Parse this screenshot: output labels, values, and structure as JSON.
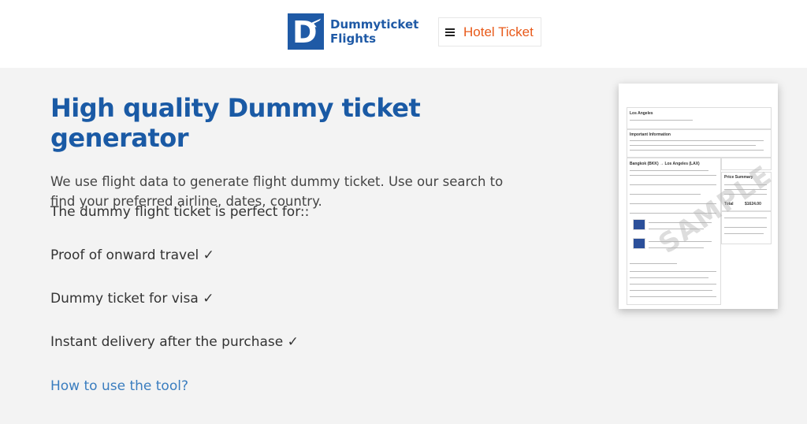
{
  "header": {
    "logo": {
      "line1": "Dummyticket",
      "line2": "Flights"
    },
    "hotel_button": {
      "label": "Hotel Ticket"
    }
  },
  "main": {
    "title": "High quality Dummy ticket generator",
    "intro": "We use flight data to generate flight dummy ticket. Use our search to find your preferred airline, dates, country.",
    "perfect_for": "The dummy flight ticket is perfect for::",
    "features": [
      "Proof of onward travel ✓",
      "Dummy ticket for visa ✓",
      "Instant delivery after the purchase  ✓"
    ],
    "how_link": "How to use the tool?"
  },
  "sample": {
    "city": "Los Angeles",
    "section1": "Important Information",
    "route": "Bangkok (BKK) → Los Angeles (LAX)",
    "price_summary": "Price Summary",
    "total": "Total",
    "total_value": "$1624.00",
    "watermark": "SAMPLE"
  },
  "colors": {
    "brand_blue": "#1f5aa6",
    "title_blue": "#1a5aa5",
    "hotel_orange": "#e85a1a",
    "link_blue": "#3a7dbf"
  }
}
